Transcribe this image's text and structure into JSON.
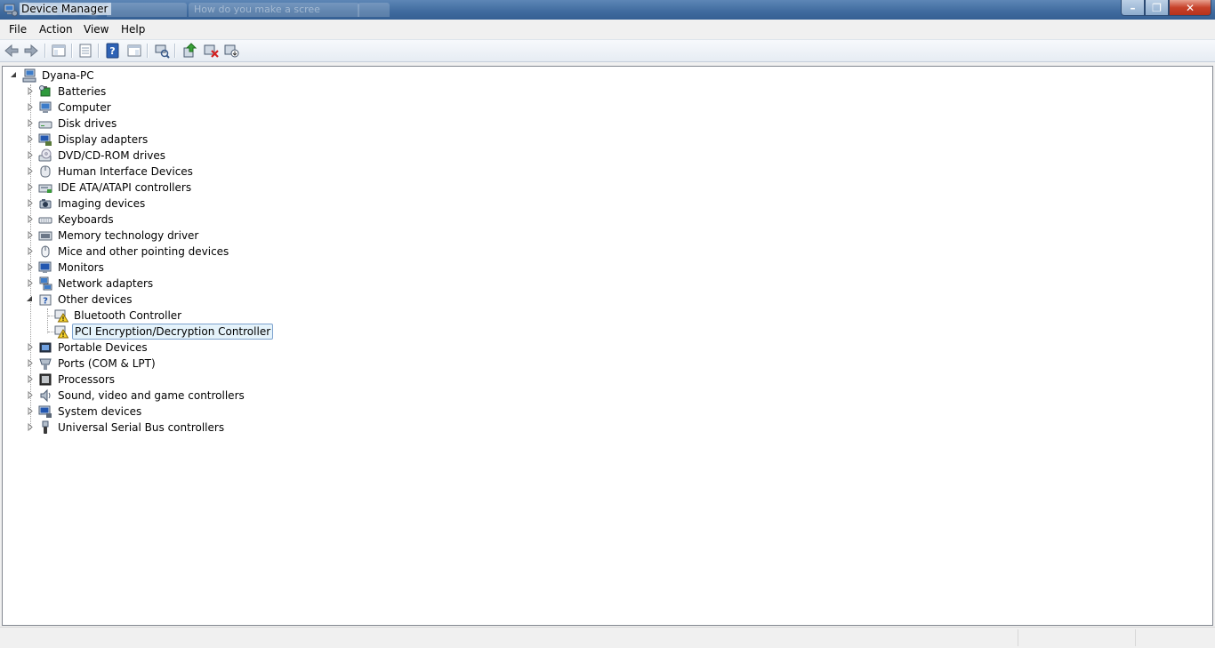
{
  "window": {
    "title": "Device Manager",
    "background_tabs": [
      "",
      "How do you make a scree",
      ""
    ]
  },
  "menu": [
    "File",
    "Action",
    "View",
    "Help"
  ],
  "toolbar": {
    "buttons": [
      "back-icon",
      "forward-icon",
      "show-hide-console-tree-icon",
      "properties-icon",
      "help-icon",
      "show-hide-action-pane-icon",
      "scan-hardware-changes-icon",
      "update-driver-icon",
      "uninstall-icon",
      "disable-icon"
    ]
  },
  "tree": {
    "root": "Dyana-PC",
    "categories": [
      {
        "label": "Batteries",
        "icon": "battery-icon",
        "expanded": false
      },
      {
        "label": "Computer",
        "icon": "computer-icon",
        "expanded": false
      },
      {
        "label": "Disk drives",
        "icon": "disk-drive-icon",
        "expanded": false
      },
      {
        "label": "Display adapters",
        "icon": "display-adapter-icon",
        "expanded": false
      },
      {
        "label": "DVD/CD-ROM drives",
        "icon": "dvd-drive-icon",
        "expanded": false
      },
      {
        "label": "Human Interface Devices",
        "icon": "hid-icon",
        "expanded": false
      },
      {
        "label": "IDE ATA/ATAPI controllers",
        "icon": "ide-controller-icon",
        "expanded": false
      },
      {
        "label": "Imaging devices",
        "icon": "camera-icon",
        "expanded": false
      },
      {
        "label": "Keyboards",
        "icon": "keyboard-icon",
        "expanded": false
      },
      {
        "label": "Memory technology driver",
        "icon": "memory-icon",
        "expanded": false
      },
      {
        "label": "Mice and other pointing devices",
        "icon": "mouse-icon",
        "expanded": false
      },
      {
        "label": "Monitors",
        "icon": "monitor-icon",
        "expanded": false
      },
      {
        "label": "Network adapters",
        "icon": "network-icon",
        "expanded": false
      },
      {
        "label": "Other devices",
        "icon": "unknown-device-icon",
        "expanded": true,
        "children": [
          {
            "label": "Bluetooth Controller",
            "icon": "warning-device-icon",
            "selected": false
          },
          {
            "label": "PCI Encryption/Decryption Controller",
            "icon": "warning-device-icon",
            "selected": true
          }
        ]
      },
      {
        "label": "Portable Devices",
        "icon": "portable-device-icon",
        "expanded": false
      },
      {
        "label": "Ports (COM & LPT)",
        "icon": "port-icon",
        "expanded": false
      },
      {
        "label": "Processors",
        "icon": "processor-icon",
        "expanded": false
      },
      {
        "label": "Sound, video and game controllers",
        "icon": "speaker-icon",
        "expanded": false
      },
      {
        "label": "System devices",
        "icon": "system-device-icon",
        "expanded": false
      },
      {
        "label": "Universal Serial Bus controllers",
        "icon": "usb-icon",
        "expanded": false
      }
    ]
  },
  "status": ""
}
